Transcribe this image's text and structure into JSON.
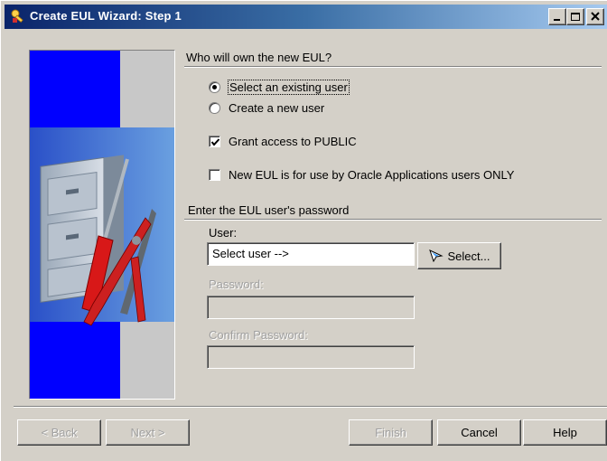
{
  "window": {
    "title": "Create EUL Wizard: Step 1"
  },
  "owner_section": {
    "heading": "Who will own the new EUL?",
    "options": [
      {
        "label": "Select an existing user",
        "mnemonic_index": 10,
        "selected": true
      },
      {
        "label": "Create a new user",
        "mnemonic_index": 0,
        "selected": false
      }
    ],
    "grant_public": {
      "label": "Grant access to PUBLIC",
      "mnemonic_index": 0,
      "checked": true
    },
    "oracle_apps": {
      "label": "New EUL is for use by Oracle Applications users ONLY",
      "mnemonic_index": 2,
      "checked": false
    }
  },
  "password_section": {
    "heading": "Enter the EUL user's password",
    "user_label": "User:",
    "user_value": "Select user -->",
    "select_button": "Select...",
    "password_label": "Password:",
    "password_value": "",
    "confirm_label": "Confirm Password:",
    "confirm_value": ""
  },
  "footer": {
    "back": "< Back",
    "next": "Next >",
    "finish": "Finish",
    "cancel": "Cancel",
    "help": "Help"
  },
  "icons": {
    "title": "wizard-key-icon",
    "select": "pointer-icon",
    "illustration": "filing-cabinet-tools-illustration"
  },
  "colors": {
    "titlebar_start": "#0a246a",
    "titlebar_end": "#a6caf0",
    "face": "#d4d0c8",
    "panel_blue": "#0000ff"
  }
}
